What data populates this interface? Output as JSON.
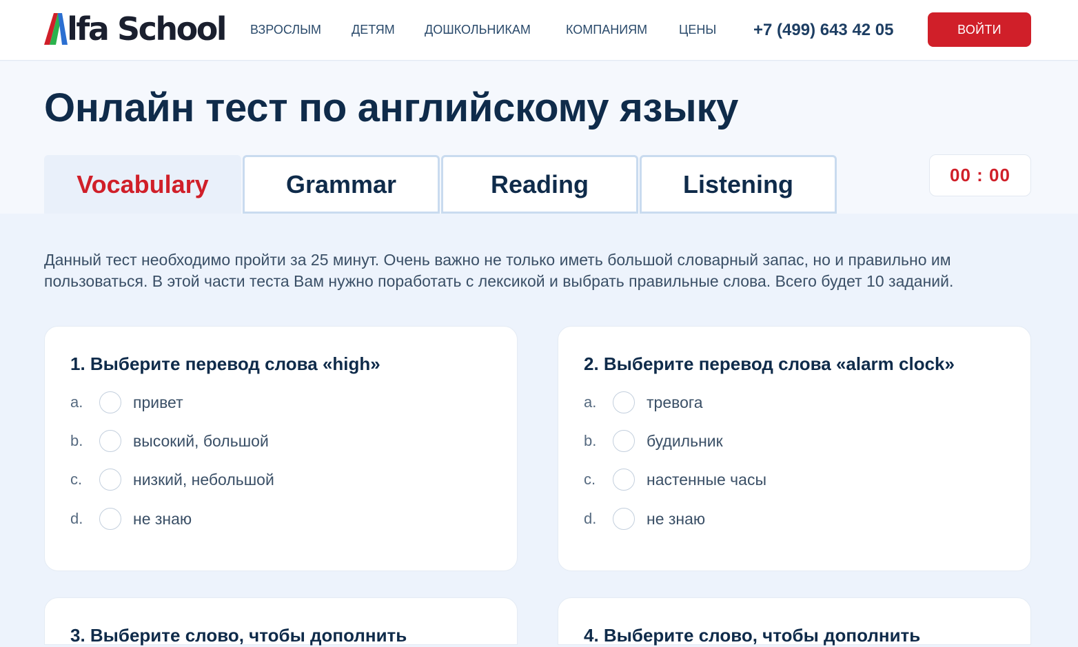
{
  "header": {
    "logo_text": "Alfa School",
    "nav": [
      "ВЗРОСЛЫМ",
      "ДЕТЯМ",
      "ДОШКОЛЬНИКАМ",
      "КОМПАНИЯМ",
      "ЦЕНЫ"
    ],
    "phone": "+7 (499) 643 42 05",
    "login_label": "ВОЙТИ"
  },
  "page_title": "Онлайн тест по английскому языку",
  "tabs": [
    {
      "label": "Vocabulary"
    },
    {
      "label": "Grammar"
    },
    {
      "label": "Reading"
    },
    {
      "label": "Listening"
    }
  ],
  "timer": "00 : 00",
  "description": "Данный тест необходимо пройти за 25 минут. Очень важно не только иметь большой словарный запас, но и правильно им пользоваться. В этой части теста Вам нужно поработать с лексикой и выбрать правильные слова. Всего будет 10 заданий.",
  "questions": [
    {
      "title": "1. Выберите перевод слова «high»",
      "options": [
        {
          "letter": "a.",
          "text": "привет"
        },
        {
          "letter": "b.",
          "text": "высокий, большой"
        },
        {
          "letter": "c.",
          "text": "низкий, небольшой"
        },
        {
          "letter": "d.",
          "text": "не знаю"
        }
      ]
    },
    {
      "title": "2. Выберите перевод слова «alarm clock»",
      "options": [
        {
          "letter": "a.",
          "text": "тревога"
        },
        {
          "letter": "b.",
          "text": "будильник"
        },
        {
          "letter": "c.",
          "text": "настенные часы"
        },
        {
          "letter": "d.",
          "text": "не знаю"
        }
      ]
    },
    {
      "title": "3. Выберите слово, чтобы дополнить"
    },
    {
      "title": "4. Выберите слово, чтобы дополнить"
    }
  ],
  "colors": {
    "brand_red": "#d01f29",
    "navy": "#0f2b4a",
    "page_bg": "#edf3fc"
  }
}
